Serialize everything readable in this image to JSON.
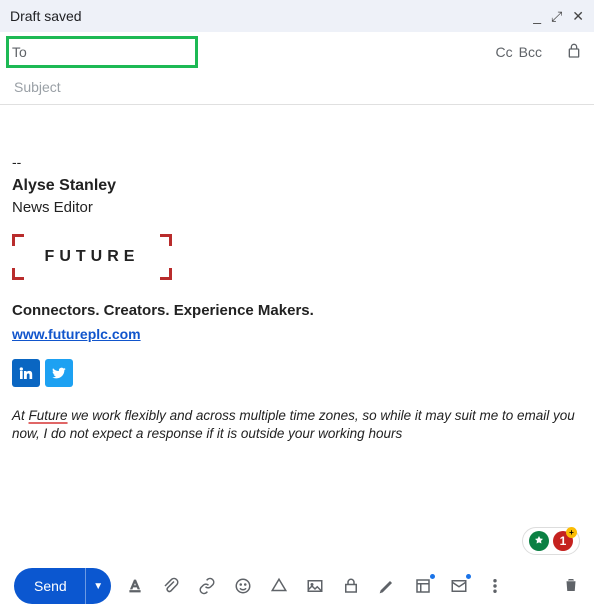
{
  "header": {
    "title": "Draft saved"
  },
  "to": {
    "label": "To",
    "value": "",
    "cc": "Cc",
    "bcc": "Bcc"
  },
  "subject": {
    "placeholder": "Subject",
    "value": ""
  },
  "signature": {
    "dashes": "--",
    "name": "Alyse Stanley",
    "role": "News Editor",
    "logo_text": "FUTURE",
    "tagline": "Connectors. Creators. Experience Makers.",
    "link_text": "www.futureplc.com",
    "disclaimer_prefix": "At ",
    "disclaimer_underlined": "Future",
    "disclaimer_rest": " we work flexibly and across multiple time zones, so while it may suit me to email you now, I do not expect a response if it is outside your working hours"
  },
  "ext_badges": {
    "red_value": "1"
  },
  "toolbar": {
    "send_label": "Send"
  }
}
